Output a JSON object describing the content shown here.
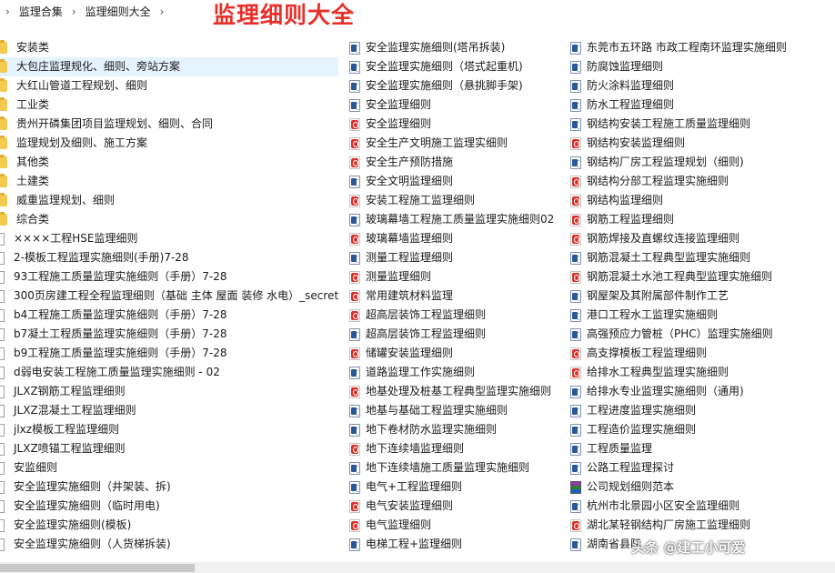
{
  "breadcrumb": [
    "监理合集",
    "监理细则大全"
  ],
  "breadcrumb_separator": "›",
  "breadcrumb_end": "›",
  "page_title": "监理细则大全",
  "colors": {
    "title": "#e8302a",
    "selection": "#e5f3ff",
    "folder": "#f3c94e"
  },
  "columns": [
    [
      {
        "icon": "folder",
        "label": "安装类"
      },
      {
        "icon": "folder",
        "label": "大包庄监理规化、细则、旁站方案",
        "selected": true
      },
      {
        "icon": "folder",
        "label": "大红山管道工程规划、细则"
      },
      {
        "icon": "folder",
        "label": "工业类"
      },
      {
        "icon": "folder",
        "label": "贵州开磷集团项目监理规划、细则、合同"
      },
      {
        "icon": "folder",
        "label": "监理规划及细则、施工方案"
      },
      {
        "icon": "folder",
        "label": "其他类"
      },
      {
        "icon": "folder",
        "label": "土建类"
      },
      {
        "icon": "folder",
        "label": "威重监理规划、细则"
      },
      {
        "icon": "folder",
        "label": "综合类"
      },
      {
        "icon": "file",
        "label": "××××工程HSE监理细则"
      },
      {
        "icon": "file",
        "label": "2-模板工程监理实施细则(手册)7-28"
      },
      {
        "icon": "file",
        "label": "93工程施工质量监理实施细则（手册）7-28"
      },
      {
        "icon": "file",
        "label": "300页房建工程全程监理细则（基础 主体 屋面 装修 水电）_secret"
      },
      {
        "icon": "file",
        "label": "b4工程施工质量监理实施细则（手册）7-28"
      },
      {
        "icon": "file",
        "label": "b7凝土工程质量监理实施细则（手册）7-28"
      },
      {
        "icon": "file",
        "label": "b9工程施工质量监理实施细则（手册）7-28"
      },
      {
        "icon": "file",
        "label": "d弱电安装工程施工质量监理实施细则 - 02"
      },
      {
        "icon": "file",
        "label": "JLXZ钢筋工程监理细则"
      },
      {
        "icon": "file",
        "label": "JLXZ混凝土工程监理细则"
      },
      {
        "icon": "file",
        "label": "jlxz模板工程监理细则"
      },
      {
        "icon": "file",
        "label": "JLXZ喷锚工程监理细则"
      },
      {
        "icon": "file",
        "label": "安监细则"
      },
      {
        "icon": "file",
        "label": "安全监理实施细则（井架装、拆)"
      },
      {
        "icon": "file",
        "label": "安全监理实施细则（临时用电)"
      },
      {
        "icon": "file",
        "label": "安全监理实施细则(模板)"
      },
      {
        "icon": "file",
        "label": "安全监理实施细则（人货梯拆装)"
      }
    ],
    [
      {
        "icon": "word",
        "label": "安全监理实施细则(塔吊拆装)"
      },
      {
        "icon": "word",
        "label": "安全监理实施细则（塔式起重机)"
      },
      {
        "icon": "word",
        "label": "安全监理实施细则（悬挑脚手架)"
      },
      {
        "icon": "word",
        "label": "安全监理细则"
      },
      {
        "icon": "pdf",
        "label": "安全监理细则"
      },
      {
        "icon": "pdf",
        "label": "安全生产文明施工监理实细则"
      },
      {
        "icon": "pdf",
        "label": "安全生产预防措施"
      },
      {
        "icon": "word",
        "label": "安全文明监理细则"
      },
      {
        "icon": "pdf",
        "label": "安装工程施工监理细则"
      },
      {
        "icon": "word",
        "label": "玻璃幕墙工程施工质量监理实施细则02"
      },
      {
        "icon": "pdf",
        "label": "玻璃幕墙监理细则"
      },
      {
        "icon": "word",
        "label": "测量工程监理细则"
      },
      {
        "icon": "pdf",
        "label": "测量监理细则"
      },
      {
        "icon": "pdf",
        "label": "常用建筑材料监理"
      },
      {
        "icon": "pdf",
        "label": "超高层装饰工程监理细则"
      },
      {
        "icon": "word",
        "label": "超高层装饰工程监理细则"
      },
      {
        "icon": "pdf",
        "label": "储罐安装监理细则"
      },
      {
        "icon": "word",
        "label": "道路监理工作实施细则"
      },
      {
        "icon": "pdf",
        "label": "地基处理及桩基工程典型监理实施细则"
      },
      {
        "icon": "word",
        "label": "地基与基础工程监理实施细则"
      },
      {
        "icon": "word",
        "label": "地下卷材防水监理实施细则"
      },
      {
        "icon": "pdf",
        "label": "地下连续墙监理细则"
      },
      {
        "icon": "word",
        "label": "地下连续墙施工质量监理实施细则"
      },
      {
        "icon": "word",
        "label": "电气+工程监理细则"
      },
      {
        "icon": "pdf",
        "label": "电气安装监理细则"
      },
      {
        "icon": "pdf",
        "label": "电气监理细则"
      },
      {
        "icon": "word",
        "label": "电梯工程+监理细则"
      }
    ],
    [
      {
        "icon": "word",
        "label": "东莞市五环路 市政工程南环监理实施细则"
      },
      {
        "icon": "word",
        "label": "防腐蚀监理细则"
      },
      {
        "icon": "word",
        "label": "防火涂料监理细则"
      },
      {
        "icon": "word",
        "label": "防水工程监理细则"
      },
      {
        "icon": "word",
        "label": "钢结构安装工程施工质量监理细则"
      },
      {
        "icon": "pdf",
        "label": "钢结构安装监理细则"
      },
      {
        "icon": "word",
        "label": "钢结构厂房工程监理规划（细则)"
      },
      {
        "icon": "pdf",
        "label": "钢结构分部工程监理实施细则"
      },
      {
        "icon": "pdf",
        "label": "钢结构监理细则"
      },
      {
        "icon": "pdf",
        "label": "钢筋工程监理细则"
      },
      {
        "icon": "pdf",
        "label": "钢筋焊接及直螺纹连接监理细则"
      },
      {
        "icon": "word",
        "label": "钢筋混凝土工程典型监理实施细则"
      },
      {
        "icon": "pdf",
        "label": "钢筋混凝土水池工程典型监理实施细则"
      },
      {
        "icon": "word",
        "label": "钢屋架及其附属部件制作工艺"
      },
      {
        "icon": "word",
        "label": "港口工程水工监理实施细则"
      },
      {
        "icon": "word",
        "label": "高强预应力管桩（PHC）监理实施细则"
      },
      {
        "icon": "pdf",
        "label": "高支撑模板工程监理细则"
      },
      {
        "icon": "pdf",
        "label": "给排水工程典型监理实施细则"
      },
      {
        "icon": "word",
        "label": "给排水专业监理实施细则（通用)"
      },
      {
        "icon": "word",
        "label": "工程进度监理实施细则"
      },
      {
        "icon": "word",
        "label": "工程造价监理实施细则"
      },
      {
        "icon": "word",
        "label": "工程质量监理"
      },
      {
        "icon": "word",
        "label": "公路工程监理探讨"
      },
      {
        "icon": "rar",
        "label": "公司规划细则范本"
      },
      {
        "icon": "word",
        "label": "杭州市北景园小区安全监理细则"
      },
      {
        "icon": "pdf",
        "label": "湖北某轻钢结构厂房施工监理细则"
      },
      {
        "icon": "word",
        "label": "湖南省县际"
      }
    ]
  ],
  "watermark": {
    "text": "头条 @建工小可爱"
  }
}
